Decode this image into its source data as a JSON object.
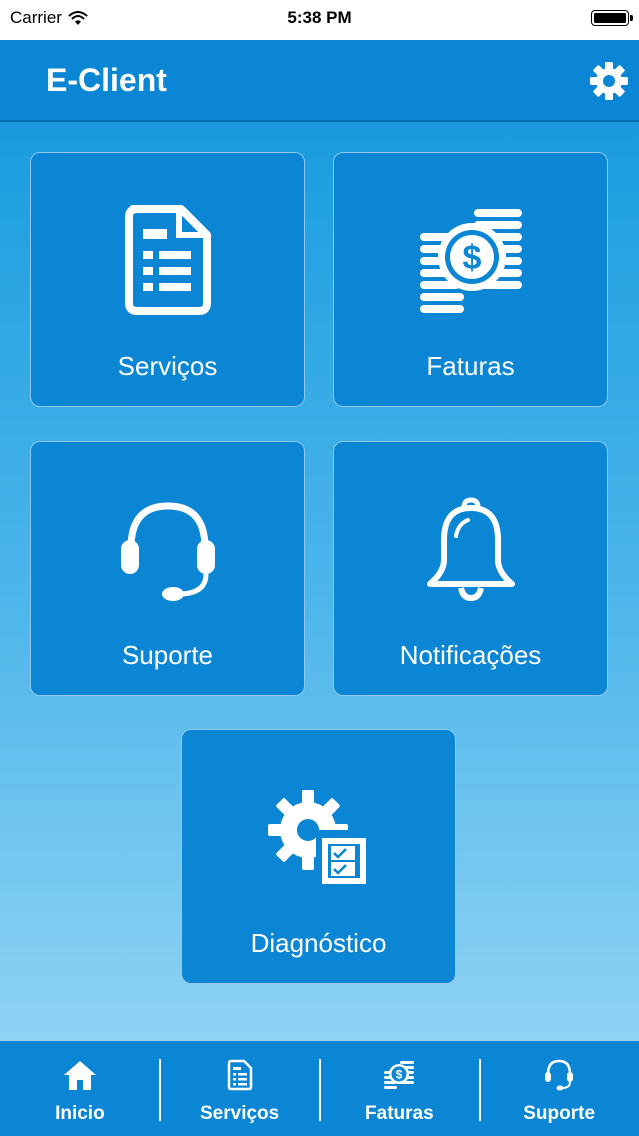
{
  "status_bar": {
    "carrier": "Carrier",
    "time": "5:38 PM"
  },
  "header": {
    "title": "E-Client",
    "settings_icon": "gear-icon"
  },
  "tiles": [
    {
      "label": "Serviços",
      "icon": "document-list-icon"
    },
    {
      "label": "Faturas",
      "icon": "coins-dollar-icon"
    },
    {
      "label": "Suporte",
      "icon": "headset-icon"
    },
    {
      "label": "Notificações",
      "icon": "bell-icon"
    },
    {
      "label": "Diagnóstico",
      "icon": "gear-checklist-icon"
    }
  ],
  "tab_bar": {
    "items": [
      {
        "label": "Inicio",
        "icon": "home-icon"
      },
      {
        "label": "Serviços",
        "icon": "document-list-icon"
      },
      {
        "label": "Faturas",
        "icon": "coins-dollar-icon"
      },
      {
        "label": "Suporte",
        "icon": "headset-icon"
      }
    ]
  },
  "colors": {
    "primary": "#0a86d4",
    "background_top": "#1fa0e0",
    "background_bottom": "#8fd3f4",
    "text": "#ffffff"
  }
}
